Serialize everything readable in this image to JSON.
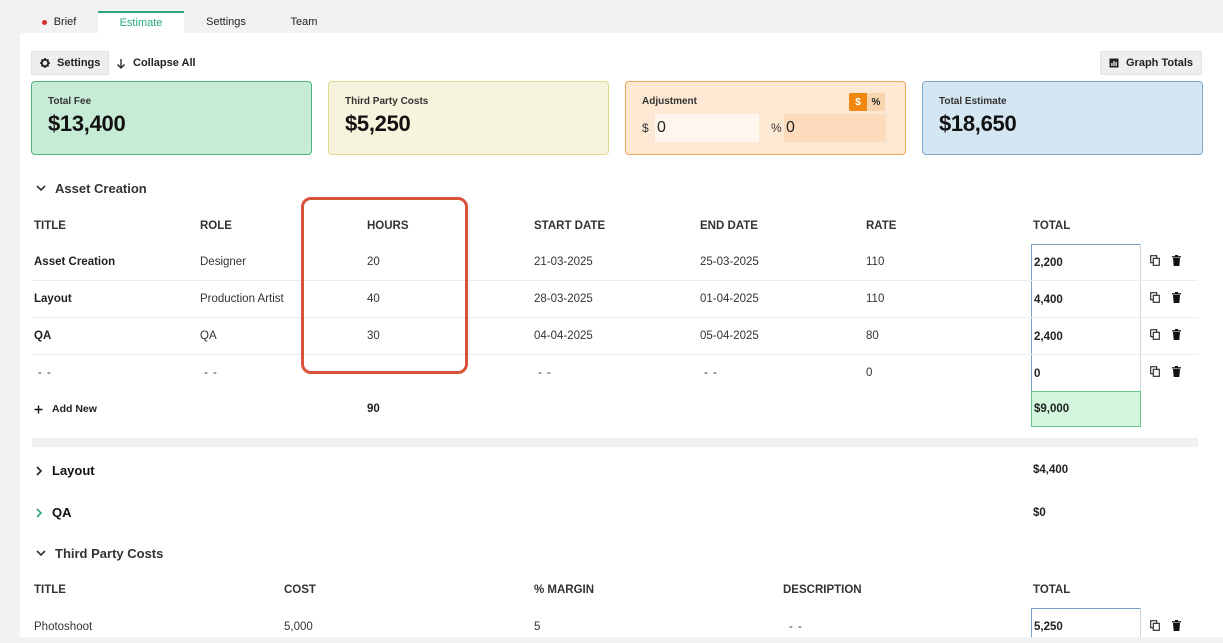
{
  "tabs": [
    {
      "label": "Brief"
    },
    {
      "label": "Estimate"
    },
    {
      "label": "Settings"
    },
    {
      "label": "Team"
    }
  ],
  "toolbar": {
    "settings_label": "Settings",
    "collapse_label": "Collapse All",
    "graph_label": "Graph Totals"
  },
  "summary": {
    "fee_label": "Total Fee",
    "fee_value": "$13,400",
    "third_label": "Third Party Costs",
    "third_value": "$5,250",
    "adj_label": "Adjustment",
    "adj_toggle_dollar": "$",
    "adj_toggle_percent": "%",
    "adj_dollar_symbol": "$",
    "adj_dollar_value": "0",
    "adj_percent_symbol": "%",
    "adj_percent_value": "0",
    "total_label": "Total Estimate",
    "total_value": "$18,650"
  },
  "asset_section": {
    "title": "Asset Creation",
    "headers": {
      "title": "TITLE",
      "role": "ROLE",
      "hours": "HOURS",
      "start": "START DATE",
      "end": "END DATE",
      "rate": "RATE",
      "total": "TOTAL"
    },
    "rows": [
      {
        "title": "Asset Creation",
        "role": "Designer",
        "hours": "20",
        "start": "21-03-2025",
        "end": "25-03-2025",
        "rate": "110",
        "total": "2,200"
      },
      {
        "title": "Layout",
        "role": "Production Artist",
        "hours": "40",
        "start": "28-03-2025",
        "end": "01-04-2025",
        "rate": "110",
        "total": "4,400"
      },
      {
        "title": "QA",
        "role": "QA",
        "hours": "30",
        "start": "04-04-2025",
        "end": "05-04-2025",
        "rate": "80",
        "total": "2,400"
      },
      {
        "title": "- -",
        "role": "- -",
        "hours": "",
        "start": "- -",
        "end": "- -",
        "rate": "0",
        "total": "0"
      }
    ],
    "add_new_label": "Add New",
    "hours_sum": "90",
    "total_sum": "$9,000"
  },
  "layout_section": {
    "title": "Layout",
    "total": "$4,400"
  },
  "qa_section": {
    "title": "QA",
    "total": "$0"
  },
  "third_party_section": {
    "title": "Third Party Costs",
    "headers": {
      "title": "TITLE",
      "cost": "COST",
      "margin": "% MARGIN",
      "description": "DESCRIPTION",
      "total": "TOTAL"
    },
    "rows": [
      {
        "title": "Photoshoot",
        "cost": "5,000",
        "margin": "5",
        "description": "- -",
        "total": "5,250"
      }
    ]
  },
  "colors": {
    "accent": "#2aa876",
    "highlight": "#d9533b",
    "adjust_orange": "#f0870f"
  }
}
